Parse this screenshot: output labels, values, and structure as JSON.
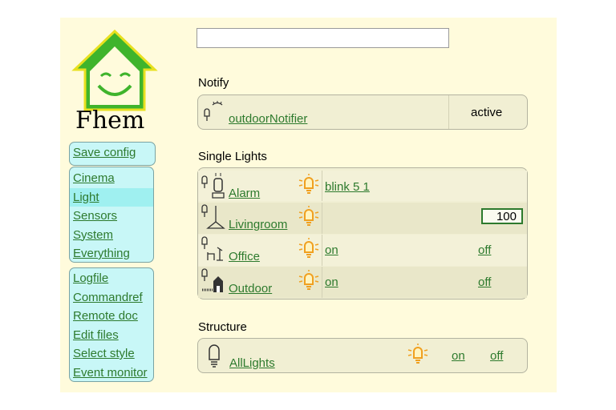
{
  "logo": {
    "text": "Fhem"
  },
  "search": {
    "placeholder": "",
    "value": ""
  },
  "menu": {
    "top": [
      {
        "label": "Save config"
      }
    ],
    "rooms": [
      {
        "label": "Cinema"
      },
      {
        "label": "Light"
      },
      {
        "label": "Sensors"
      },
      {
        "label": "System"
      },
      {
        "label": "Everything"
      }
    ],
    "tools": [
      {
        "label": "Logfile"
      },
      {
        "label": "Commandref"
      },
      {
        "label": "Remote doc"
      },
      {
        "label": "Edit files"
      },
      {
        "label": "Select style"
      },
      {
        "label": "Event monitor"
      }
    ]
  },
  "notify": {
    "title": "Notify",
    "devices": [
      {
        "name": "outdoorNotifier",
        "state": "active"
      }
    ]
  },
  "single_lights": {
    "title": "Single Lights",
    "devices": [
      {
        "name": "Alarm",
        "state": "blink 5 1",
        "icon": "alarm-siren-icon"
      },
      {
        "name": "Livingroom",
        "dim_value": "100",
        "icon": "ceiling-lamp-icon"
      },
      {
        "name": "Office",
        "on": "on",
        "off": "off",
        "icon": "desk-lamp-icon"
      },
      {
        "name": "Outdoor",
        "on": "on",
        "off": "off",
        "icon": "house-light-icon"
      }
    ]
  },
  "structure": {
    "title": "Structure",
    "devices": [
      {
        "name": "AllLights",
        "on": "on",
        "off": "off"
      }
    ]
  },
  "colors": {
    "link": "#2d7a2d",
    "background": "#fffbdc",
    "menu": "#c8f7f7",
    "bulb": "#f0a020"
  }
}
